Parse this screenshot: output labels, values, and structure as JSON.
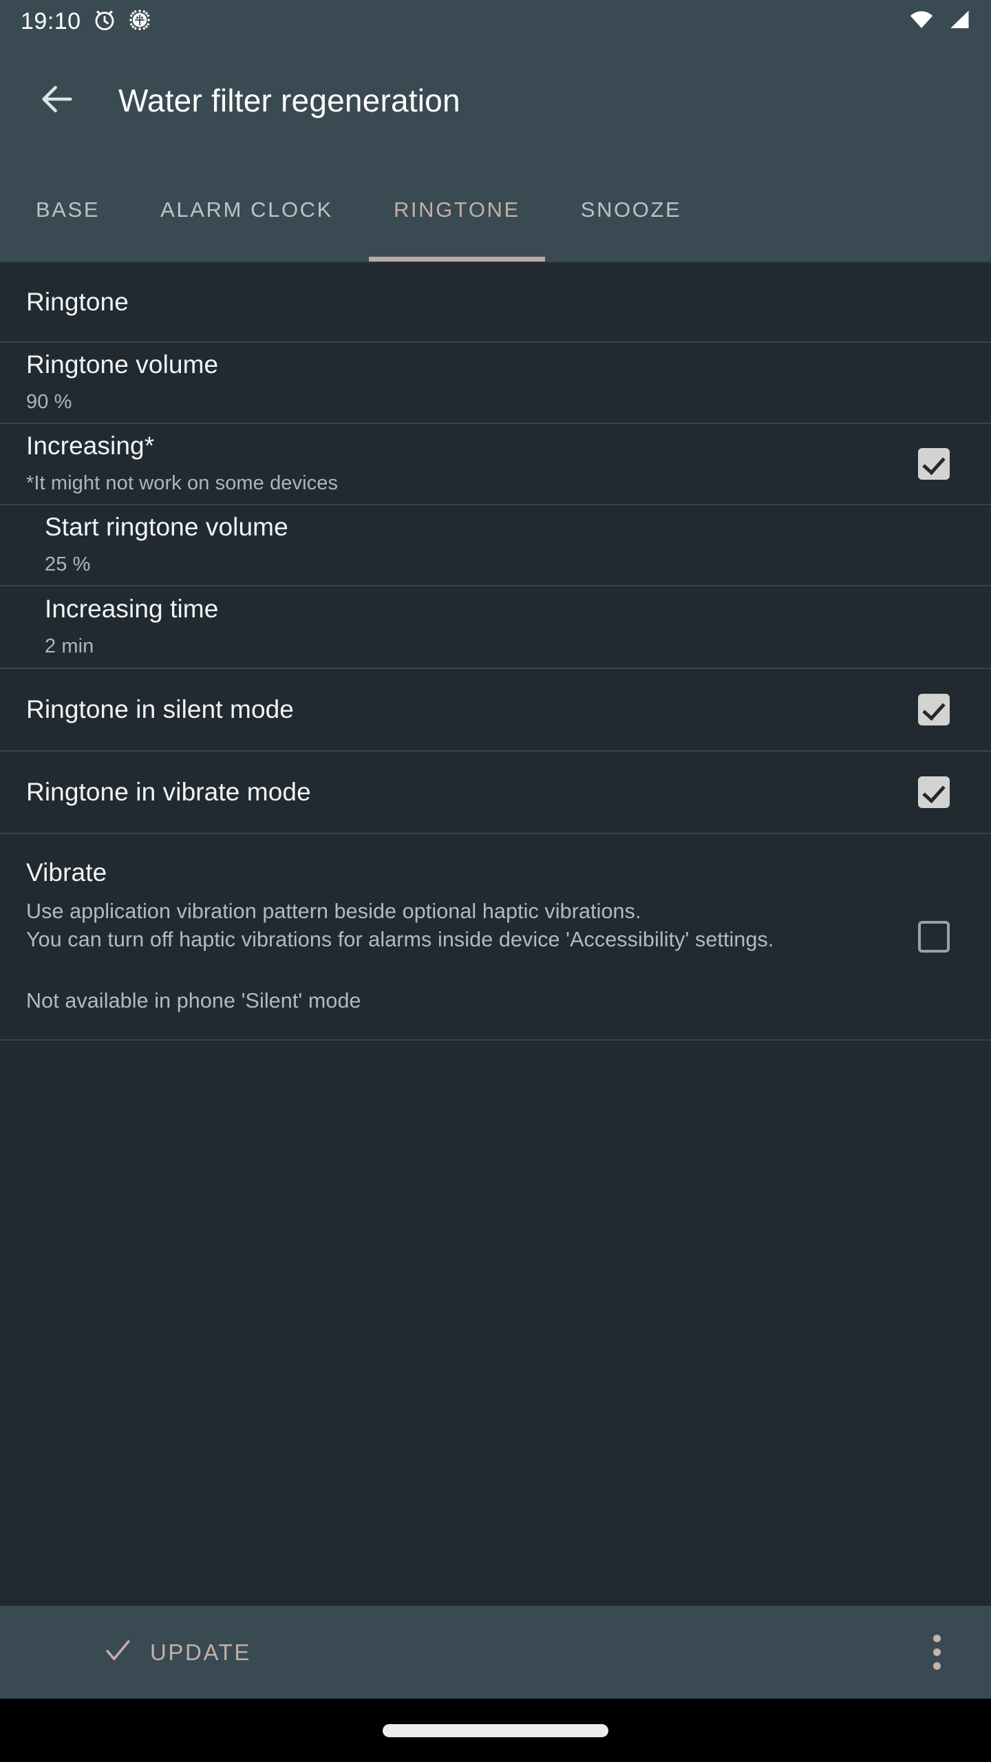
{
  "status_bar": {
    "time": "19:10",
    "icons_left": [
      "alarm-clock-icon",
      "gear-bug-icon"
    ],
    "icons_right": [
      "wifi-icon",
      "cellular-signal-icon"
    ]
  },
  "toolbar": {
    "back_icon": "back-arrow-icon",
    "title": "Water filter regeneration"
  },
  "tabs": {
    "active_index": 2,
    "active_color": "#c3afa8",
    "inactive_color": "#b9c4c9",
    "indicator_color": "#bdaaa4",
    "items": [
      {
        "label": "BASE"
      },
      {
        "label": "ALARM CLOCK"
      },
      {
        "label": "RINGTONE"
      },
      {
        "label": "SNOOZE"
      }
    ]
  },
  "settings": {
    "ringtone": {
      "title": "Ringtone"
    },
    "ringtone_volume": {
      "title": "Ringtone volume",
      "value": "90 %"
    },
    "increasing": {
      "title": "Increasing*",
      "subtitle": "*It might not work on some devices",
      "checked": true
    },
    "start_ringtone_volume": {
      "title": "Start ringtone volume",
      "value": "25 %"
    },
    "increasing_time": {
      "title": "Increasing time",
      "value": "2 min"
    },
    "ringtone_silent_mode": {
      "title": "Ringtone in silent mode",
      "checked": true
    },
    "ringtone_vibrate_mode": {
      "title": "Ringtone in vibrate mode",
      "checked": true
    },
    "vibrate": {
      "title": "Vibrate",
      "description": "Use application vibration pattern beside optional haptic vibrations.\nYou can turn off haptic vibrations for alarms inside device 'Accessibility' settings.",
      "note": "Not available in phone 'Silent' mode",
      "checked": false
    }
  },
  "bottom_bar": {
    "update_label": "UPDATE",
    "check_icon": "check-icon",
    "overflow_icon": "overflow-menu-icon"
  },
  "colors": {
    "toolbar_bg": "#3a4a52",
    "list_bg": "#222a31",
    "divider": "#38424b",
    "accent": "#c3afa8",
    "checkbox_checked": "#d3d4d2",
    "checkbox_unchecked_border": "#9aa2a7"
  }
}
